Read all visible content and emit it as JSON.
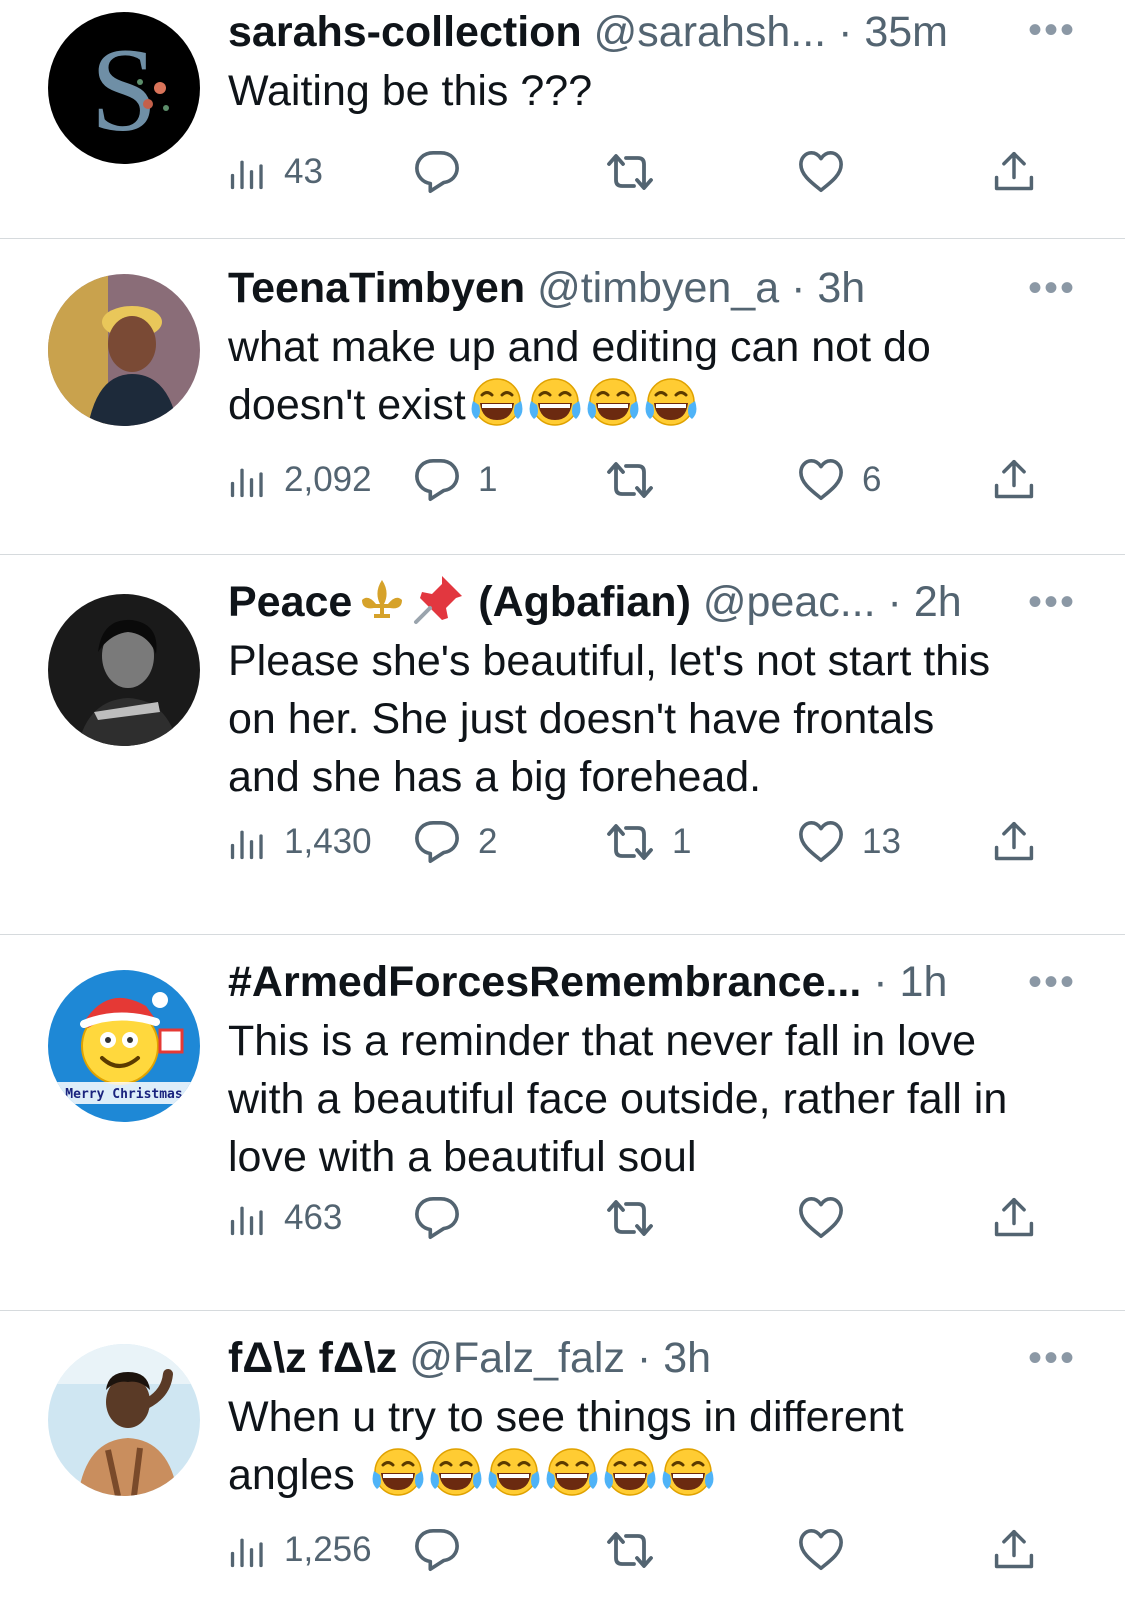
{
  "tweets": [
    {
      "name": "sarahs-collection",
      "handle": "@sarahsh...",
      "time": "· 35m",
      "text": "Waiting be this ???",
      "emoji_count": 0,
      "views": "43",
      "replies": "",
      "retweets": "",
      "likes": "",
      "avatar_icon": "letter-s-avatar"
    },
    {
      "name": "TeenaTimbyen",
      "handle": "@timbyen_a",
      "time": "· 3h",
      "text_line1": "what make up and editing can not do",
      "text_line2": "doesn't exist",
      "emoji_count": 4,
      "views": "2,092",
      "replies": "1",
      "retweets": "",
      "likes": "6",
      "avatar_icon": "woman-portrait-avatar"
    },
    {
      "name": "Peace",
      "name_suffix": "(Agbafian)",
      "handle": "@peac...",
      "time": "· 2h",
      "text_line1": "Please she's beautiful, let's not start this",
      "text_line2": "on her. She just doesn't have frontals",
      "text_line3": "and she has a big forehead.",
      "views": "1,430",
      "replies": "2",
      "retweets": "1",
      "likes": "13",
      "avatar_icon": "bw-portrait-avatar"
    },
    {
      "name": "#ArmedForcesRemembrance...",
      "handle": "",
      "time": "· 1h",
      "text_line1": "This is a reminder that never fall in love",
      "text_line2": "with a beautiful face outside, rather fall in",
      "text_line3": "love with a beautiful soul",
      "views": "463",
      "replies": "",
      "retweets": "",
      "likes": "",
      "avatar_icon": "christmas-emoji-avatar",
      "avatar_text": "Merry Christmas"
    },
    {
      "name": "fΔ\\z fΔ\\z",
      "handle": "@Falz_falz",
      "time": "· 3h",
      "text_line1": "When u try to see things in different",
      "text_line2": "angles",
      "emoji_count": 6,
      "views": "1,256",
      "replies": "",
      "retweets": "",
      "likes": "",
      "avatar_icon": "man-portrait-avatar"
    }
  ],
  "more_glyph": "•••",
  "colors": {
    "text": "#0f1419",
    "secondary": "#536471",
    "divider": "#d6dadd"
  }
}
